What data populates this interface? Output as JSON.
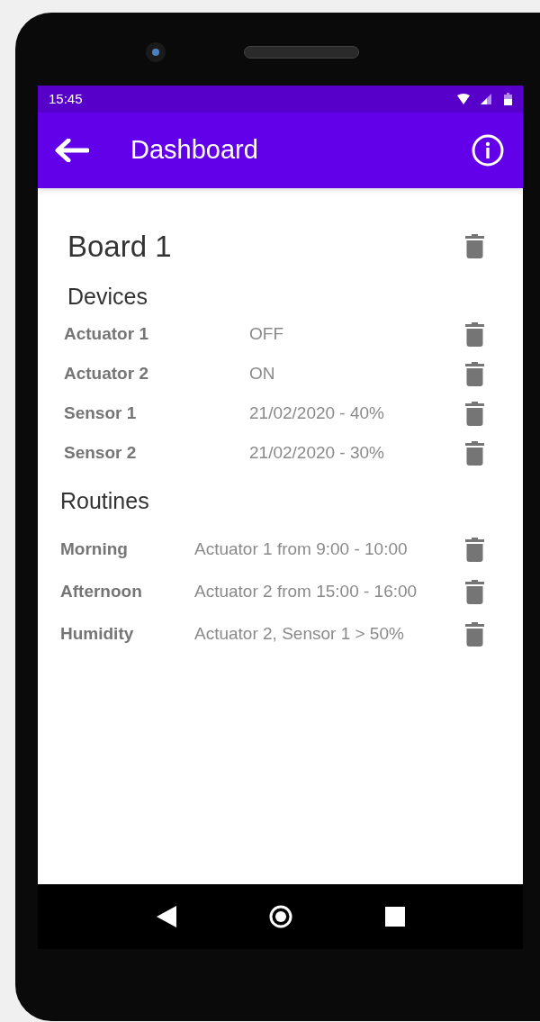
{
  "status_bar": {
    "time": "15:45"
  },
  "app_bar": {
    "title": "Dashboard"
  },
  "board": {
    "title": "Board 1"
  },
  "devices": {
    "heading": "Devices",
    "items": [
      {
        "name": "Actuator 1",
        "value": "OFF"
      },
      {
        "name": "Actuator 2",
        "value": "ON"
      },
      {
        "name": "Sensor 1",
        "value": "21/02/2020 - 40%"
      },
      {
        "name": "Sensor 2",
        "value": "21/02/2020 - 30%"
      }
    ]
  },
  "routines": {
    "heading": "Routines",
    "items": [
      {
        "name": "Morning",
        "description": "Actuator 1 from 9:00 - 10:00"
      },
      {
        "name": "Afternoon",
        "description": "Actuator 2 from 15:00 - 16:00"
      },
      {
        "name": "Humidity",
        "description": "Actuator 2, Sensor 1 > 50%"
      }
    ]
  }
}
